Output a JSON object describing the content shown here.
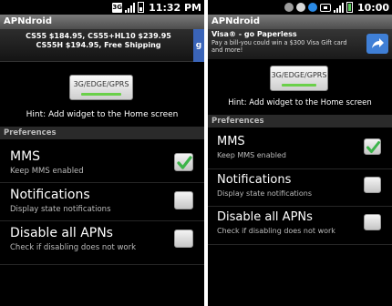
{
  "left": {
    "status": {
      "network_badge": "3G",
      "time": "11:32 PM"
    },
    "app_title": "APNdroid",
    "ad": {
      "line1": "CS55 $184.95, CS55+HL10 $239.95",
      "line2": "CS55H $194.95, Free Shipping",
      "badge": "g"
    },
    "widget_button": "3G/EDGE/GPRS",
    "hint": "Hint: Add widget to the Home screen",
    "preferences_header": "Preferences",
    "prefs": [
      {
        "title": "MMS",
        "subtitle": "Keep MMS enabled",
        "checked": true
      },
      {
        "title": "Notifications",
        "subtitle": "Display state notifications",
        "checked": false
      },
      {
        "title": "Disable all APNs",
        "subtitle": "Check if disabling does not work",
        "checked": false
      }
    ]
  },
  "right": {
    "status": {
      "time": "10:00"
    },
    "app_title": "APNdroid",
    "ad": {
      "title": "Visa® - go Paperless",
      "body": "Pay a bill-you could win a $300 Visa Gift card and more!"
    },
    "widget_button": "3G/EDGE/GPRS",
    "hint": "Hint: Add widget to the Home screen",
    "preferences_header": "Preferences",
    "prefs": [
      {
        "title": "MMS",
        "subtitle": "Keep MMS enabled",
        "checked": true
      },
      {
        "title": "Notifications",
        "subtitle": "Display state notifications",
        "checked": false
      },
      {
        "title": "Disable all APNs",
        "subtitle": "Check if disabling does not work",
        "checked": false
      }
    ]
  },
  "colors": {
    "check_green": "#3cb44a",
    "widget_green": "#6bd04a",
    "ad_blue": "#3f7fd6"
  }
}
